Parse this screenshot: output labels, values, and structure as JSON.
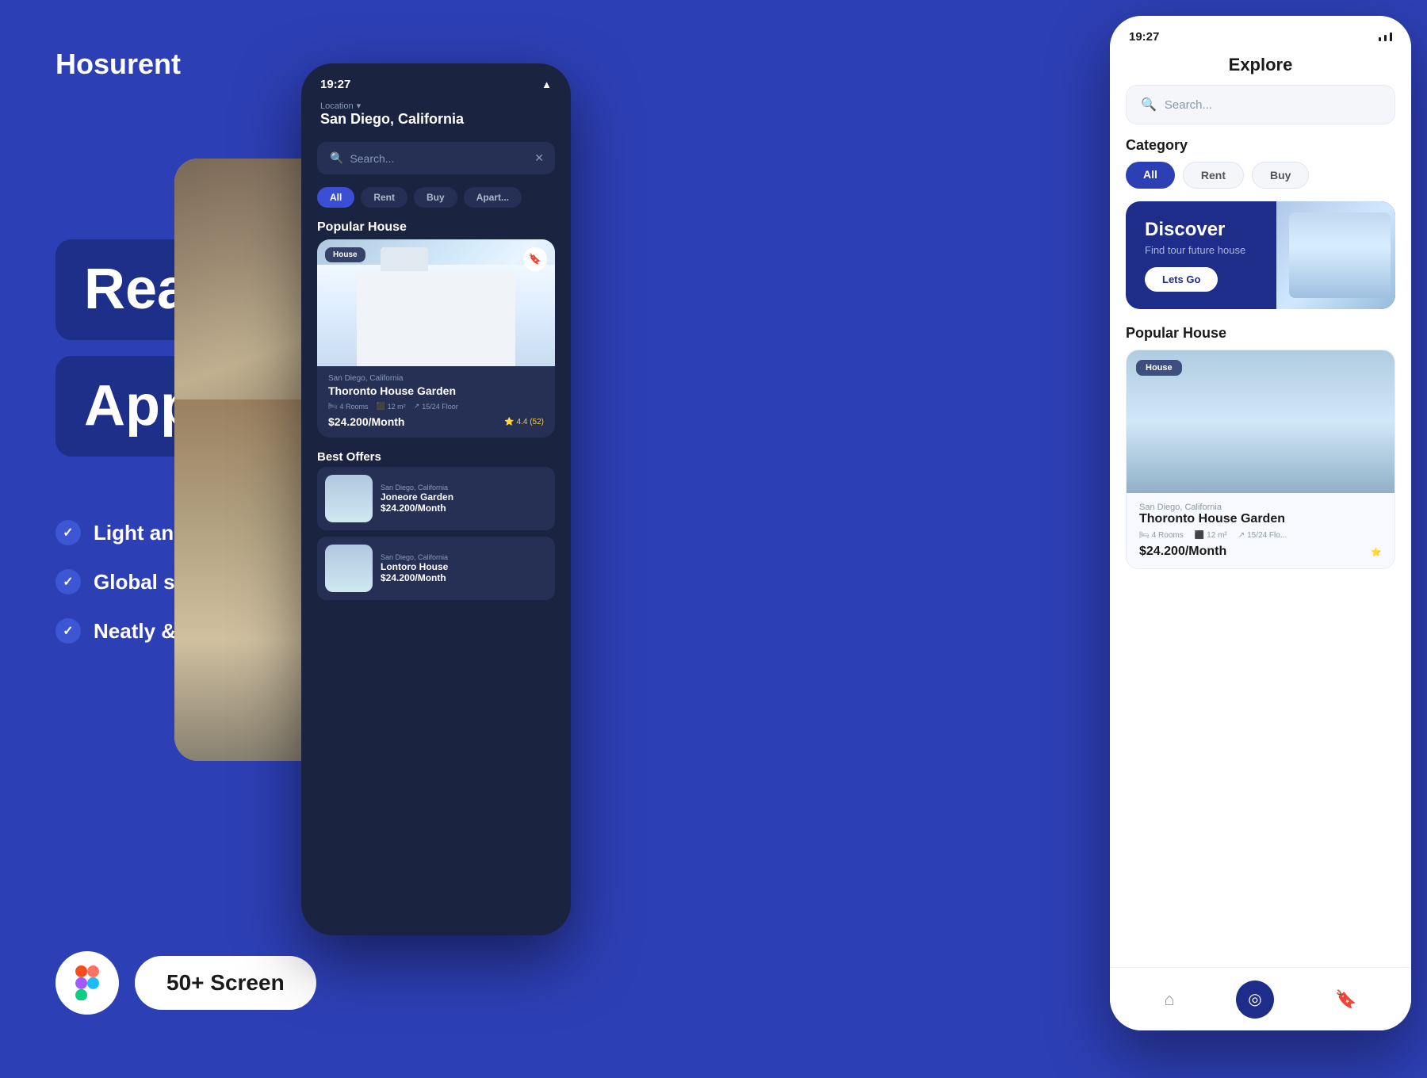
{
  "brand": {
    "name": "Hosurent"
  },
  "hero": {
    "line1": "Real Estate",
    "line2": "App UI Kits"
  },
  "features": [
    {
      "text": "Light and Dark Theme"
    },
    {
      "text": "Global style guide"
    },
    {
      "text": "Neatly & Organized Layer"
    }
  ],
  "badge": {
    "screens": "50+ Screen"
  },
  "phone_middle": {
    "status_time": "19:27",
    "location_label": "Location",
    "location_name": "San Diego, California",
    "search_placeholder": "Search...",
    "chips": [
      "All",
      "Rent",
      "Buy",
      "Apart..."
    ],
    "popular_title": "Popular House",
    "property": {
      "badge": "House",
      "location": "San Diego, California",
      "name": "Thoronto House Garden",
      "rooms": "4 Rooms",
      "size": "12 m²",
      "floor": "15/24 Floor",
      "price": "$24.200/Month",
      "rating": "4.4 (52)"
    },
    "best_offers_title": "Best Offers",
    "offers": [
      {
        "location": "San Diego, California",
        "name": "Joneore Garden",
        "price": "$24.200/Month"
      },
      {
        "location": "San Diego, California",
        "name": "Lontoro House",
        "price": "$24.200/Month"
      }
    ]
  },
  "phone_right": {
    "status_time": "19:27",
    "page_title": "Explore",
    "search_placeholder": "Search...",
    "category_label": "Category",
    "categories": [
      "All",
      "Rent",
      "Buy"
    ],
    "discover": {
      "title": "Discover",
      "subtitle": "Find tour future house",
      "button": "Lets Go"
    },
    "popular_title": "Popular House",
    "property": {
      "badge": "House",
      "location": "San Diego, California",
      "name": "Thoronto House Garden",
      "rooms": "4 Rooms",
      "size": "12 m²",
      "floor": "15/24 Flo...",
      "price": "$24.200/Month"
    },
    "nav": {
      "home_icon": "⌂",
      "compass_icon": "◎",
      "bookmark_icon": "🔖"
    }
  }
}
